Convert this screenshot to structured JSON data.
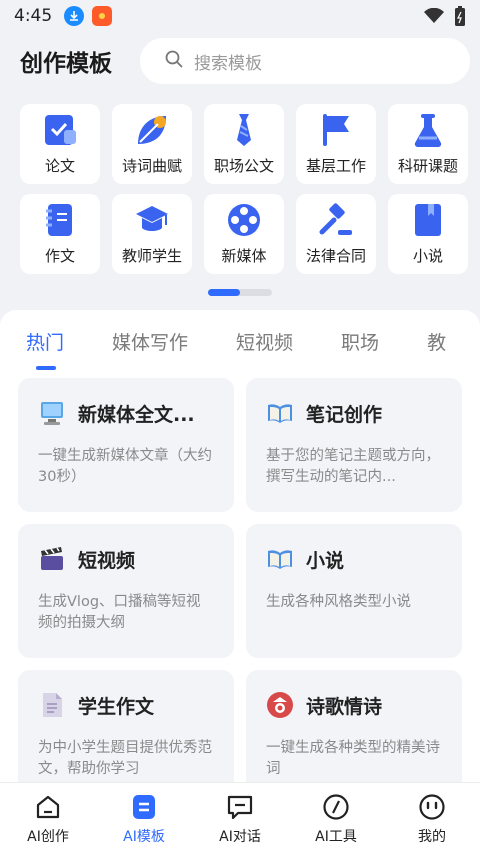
{
  "status": {
    "time": "4:45"
  },
  "header": {
    "title": "创作模板",
    "search_placeholder": "搜索模板"
  },
  "templates": {
    "row1": [
      {
        "label": "论文",
        "icon": "checklist-icon"
      },
      {
        "label": "诗词曲赋",
        "icon": "leaf-icon"
      },
      {
        "label": "职场公文",
        "icon": "tie-icon"
      },
      {
        "label": "基层工作",
        "icon": "flag-icon"
      },
      {
        "label": "科研课题",
        "icon": "flask-icon"
      }
    ],
    "row2": [
      {
        "label": "作文",
        "icon": "notebook-icon"
      },
      {
        "label": "教师学生",
        "icon": "graduation-cap-icon"
      },
      {
        "label": "新媒体",
        "icon": "film-reel-icon"
      },
      {
        "label": "法律合同",
        "icon": "gavel-icon"
      },
      {
        "label": "小说",
        "icon": "book-icon"
      }
    ]
  },
  "tabs": [
    "热门",
    "媒体写作",
    "短视频",
    "职场",
    "教"
  ],
  "cards": [
    {
      "title": "新媒体全文...",
      "desc": "一键生成新媒体文章（大约30秒）",
      "icon": "computer-icon"
    },
    {
      "title": "笔记创作",
      "desc": "基于您的笔记主题或方向，撰写生动的笔记内...",
      "icon": "open-book-icon"
    },
    {
      "title": "短视频",
      "desc": "生成Vlog、口播稿等短视频的拍摄大纲",
      "icon": "clapperboard-icon"
    },
    {
      "title": "小说",
      "desc": "生成各种风格类型小说",
      "icon": "open-book-icon"
    },
    {
      "title": "学生作文",
      "desc": "为中小学生题目提供优秀范文，帮助你学习",
      "icon": "document-icon"
    },
    {
      "title": "诗歌情诗",
      "desc": "一键生成各种类型的精美诗词",
      "icon": "poem-badge-icon"
    }
  ],
  "nav": [
    {
      "label": "AI创作",
      "icon": "home-icon"
    },
    {
      "label": "AI模板",
      "icon": "template-icon"
    },
    {
      "label": "AI对话",
      "icon": "chat-icon"
    },
    {
      "label": "AI工具",
      "icon": "compass-icon"
    },
    {
      "label": "我的",
      "icon": "profile-icon"
    }
  ],
  "colors": {
    "accent": "#2f6bff",
    "background": "#f1f2f6"
  }
}
